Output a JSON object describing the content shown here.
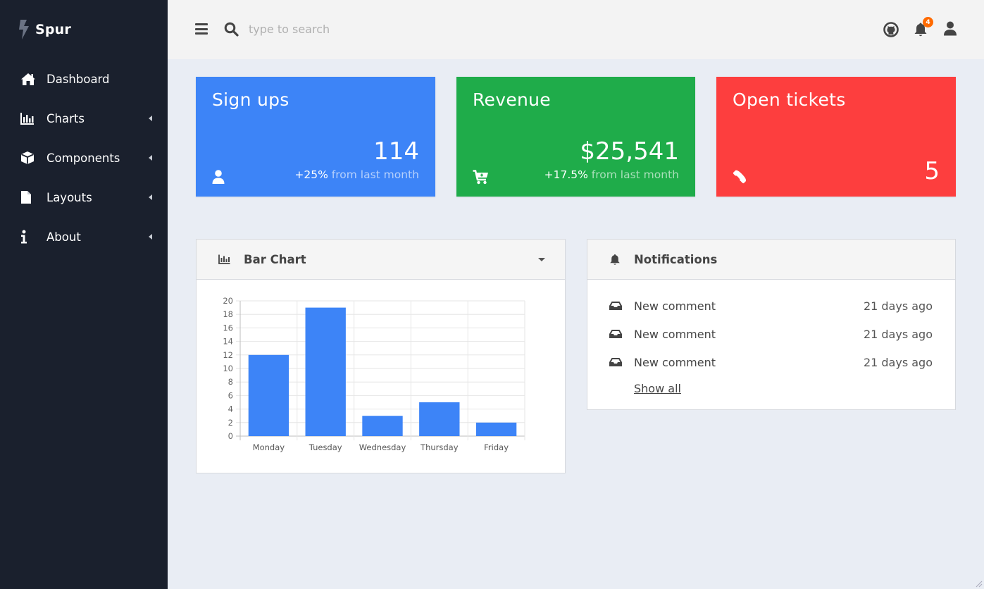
{
  "brand": {
    "name": "Spur"
  },
  "sidebar": {
    "items": [
      {
        "label": "Dashboard",
        "icon": "home-icon",
        "has_caret": false
      },
      {
        "label": "Charts",
        "icon": "bar-chart-icon",
        "has_caret": true
      },
      {
        "label": "Components",
        "icon": "cube-icon",
        "has_caret": true
      },
      {
        "label": "Layouts",
        "icon": "file-icon",
        "has_caret": true
      },
      {
        "label": "About",
        "icon": "info-icon",
        "has_caret": true
      }
    ]
  },
  "header": {
    "search_placeholder": "type to search",
    "notification_count": "4",
    "icons": [
      "menu-icon",
      "search-icon",
      "github-icon",
      "bell-icon",
      "user-icon"
    ]
  },
  "stats": {
    "signups": {
      "title": "Sign ups",
      "value": "114",
      "change": "+25%",
      "change_suffix": " from last month",
      "color": "#3d84f7",
      "icon": "user-icon"
    },
    "revenue": {
      "title": "Revenue",
      "value": "$25,541",
      "change": "+17.5%",
      "change_suffix": " from last month",
      "color": "#1fac4a",
      "icon": "cart-icon"
    },
    "tickets": {
      "title": "Open tickets",
      "value": "5",
      "color": "#fd3e3e",
      "icon": "phone-icon"
    }
  },
  "bar_panel": {
    "title": "Bar Chart"
  },
  "chart_data": {
    "type": "bar",
    "categories": [
      "Monday",
      "Tuesday",
      "Wednesday",
      "Thursday",
      "Friday"
    ],
    "values": [
      12,
      19,
      3,
      5,
      2
    ],
    "ylim": [
      0,
      20
    ],
    "yticks": [
      0,
      2,
      4,
      6,
      8,
      10,
      12,
      14,
      16,
      18,
      20
    ],
    "grid": true,
    "color": "#3d84f7"
  },
  "notifications": {
    "title": "Notifications",
    "items": [
      {
        "text": "New comment",
        "time": "21 days ago"
      },
      {
        "text": "New comment",
        "time": "21 days ago"
      },
      {
        "text": "New comment",
        "time": "21 days ago"
      }
    ],
    "show_all": "Show all"
  }
}
